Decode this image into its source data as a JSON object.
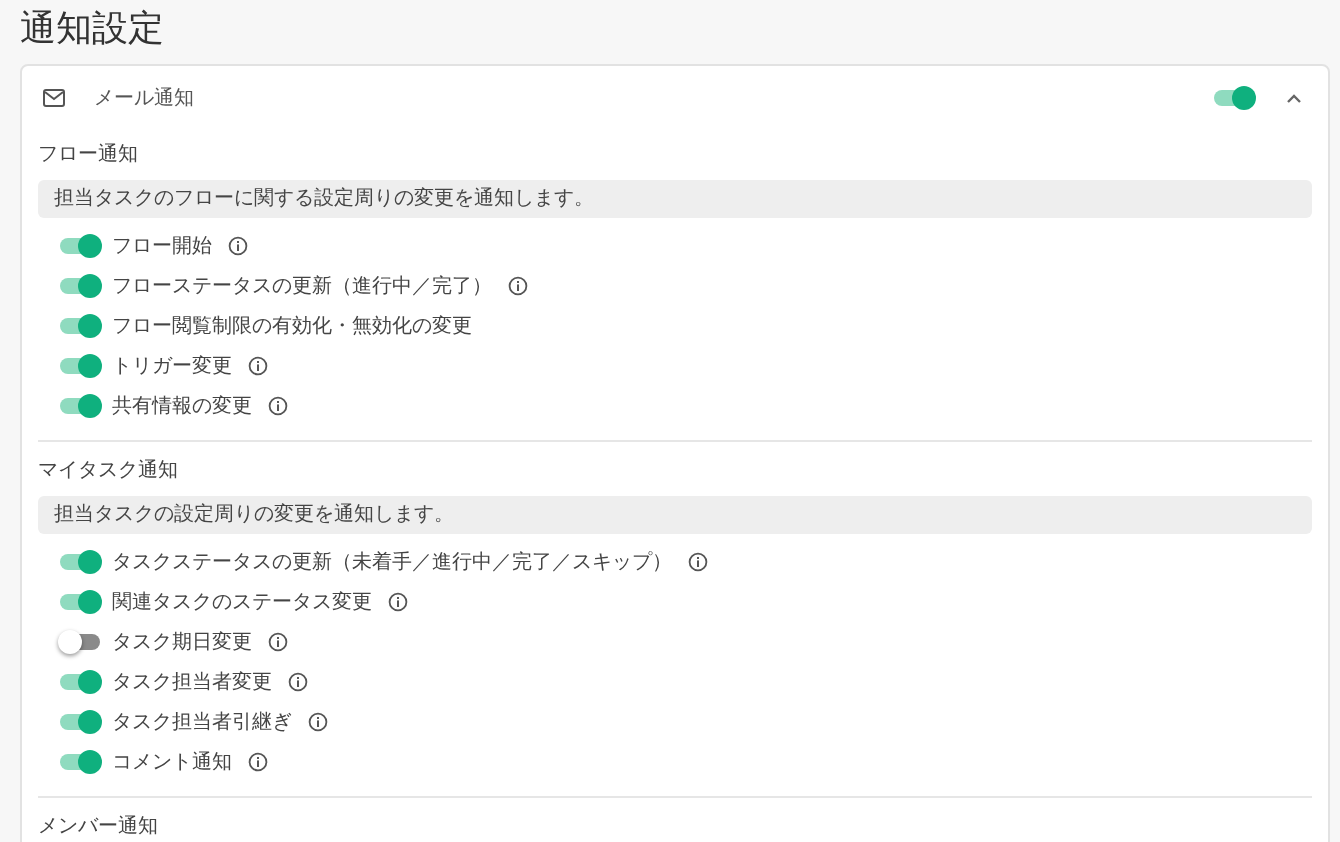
{
  "page": {
    "title": "通知設定"
  },
  "panel": {
    "title": "メール通知",
    "on": true,
    "expanded": true
  },
  "sections": [
    {
      "title": "フロー通知",
      "description": "担当タスクのフローに関する設定周りの変更を通知します。",
      "items": [
        {
          "label": "フロー開始",
          "on": true,
          "info": true
        },
        {
          "label": "フローステータスの更新（進行中／完了）",
          "on": true,
          "info": true
        },
        {
          "label": "フロー閲覧制限の有効化・無効化の変更",
          "on": true,
          "info": false
        },
        {
          "label": "トリガー変更",
          "on": true,
          "info": true
        },
        {
          "label": "共有情報の変更",
          "on": true,
          "info": true
        }
      ]
    },
    {
      "title": "マイタスク通知",
      "description": "担当タスクの設定周りの変更を通知します。",
      "items": [
        {
          "label": "タスクステータスの更新（未着手／進行中／完了／スキップ）",
          "on": true,
          "info": true
        },
        {
          "label": "関連タスクのステータス変更",
          "on": true,
          "info": true
        },
        {
          "label": "タスク期日変更",
          "on": false,
          "info": true
        },
        {
          "label": "タスク担当者変更",
          "on": true,
          "info": true
        },
        {
          "label": "タスク担当者引継ぎ",
          "on": true,
          "info": true
        },
        {
          "label": "コメント通知",
          "on": true,
          "info": true
        }
      ]
    },
    {
      "title": "メンバー通知"
    }
  ]
}
